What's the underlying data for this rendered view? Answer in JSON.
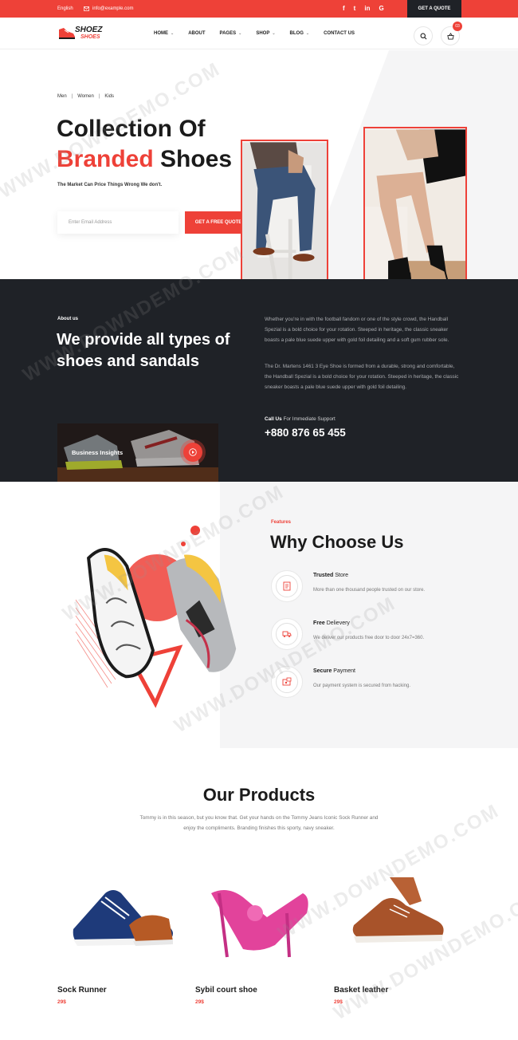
{
  "topbar": {
    "language": "English",
    "email": "info@example.com",
    "socials": [
      "f",
      "t",
      "in",
      "G"
    ],
    "quote_button": "GET A QUOTE"
  },
  "header": {
    "logo_text_1": "SHOEZ",
    "logo_text_2": "SHOES",
    "nav": [
      {
        "label": "HOME",
        "dropdown": true
      },
      {
        "label": "ABOUT",
        "dropdown": false
      },
      {
        "label": "PAGES",
        "dropdown": true
      },
      {
        "label": "SHOP",
        "dropdown": true
      },
      {
        "label": "BLOG",
        "dropdown": true
      },
      {
        "label": "CONTACT US",
        "dropdown": false
      }
    ],
    "cart_count": "03"
  },
  "hero": {
    "crumbs": [
      "Men",
      "Women",
      "Kids"
    ],
    "title_line1": "Collection Of",
    "title_red": "Branded",
    "title_rest": " Shoes",
    "subtitle": "The Market Can Price Things Wrong We don't.",
    "email_placeholder": "Enter Email Address",
    "quote_button": "GET A FREE QUOTE"
  },
  "about": {
    "tag": "About us",
    "heading": "We provide all types of shoes and sandals",
    "para1": "Whether you're in with the football fandom or one of the style crowd, the Handball Spezial is a bold choice for your rotation. Steeped in heritage, the classic sneaker boasts a pale blue suede upper with gold foil detailing and a soft gum rubber sole.",
    "para2": "The Dr. Martens 1461 3 Eye Shoe is formed from a durable, strong and comfortable, the Handball Spezial is a bold choice for your rotation. Steeped in heritage, the classic sneaker boasts a pale blue suede upper with gold foil detailing.",
    "call_bold": "Call Us",
    "call_rest": " For Immediate Support",
    "phone": "+880 876 65 455",
    "insight_label": "Business Insights"
  },
  "features": {
    "tag": "Features",
    "heading": "Why Choose Us",
    "items": [
      {
        "bold": "Trusted",
        "rest": " Store",
        "desc": "More than one thousand people trusted on our store.",
        "icon": "store-icon"
      },
      {
        "bold": "Free",
        "rest": " Delievery",
        "desc": "We deliver our products free door to door 24x7=360.",
        "icon": "truck-icon"
      },
      {
        "bold": "Secure",
        "rest": " Payment",
        "desc": "Our payment system is secured from hacking.",
        "icon": "payment-icon"
      }
    ]
  },
  "products": {
    "heading": "Our Products",
    "intro": "Tommy is in this season, but you know that. Get your hands on the Tommy Jeans Iconic Sock Runner and enjoy the compliments. Branding finishes this sporty, navy sneaker.",
    "items": [
      {
        "name": "Sock Runner",
        "price": "29$"
      },
      {
        "name": "Sybil court shoe",
        "price": "29$"
      },
      {
        "name": "Basket leather",
        "price": "29$"
      }
    ]
  },
  "colors": {
    "accent": "#ee4138",
    "dark": "#1f2227"
  },
  "watermark": "WWW.DOWNDEMO.COM"
}
